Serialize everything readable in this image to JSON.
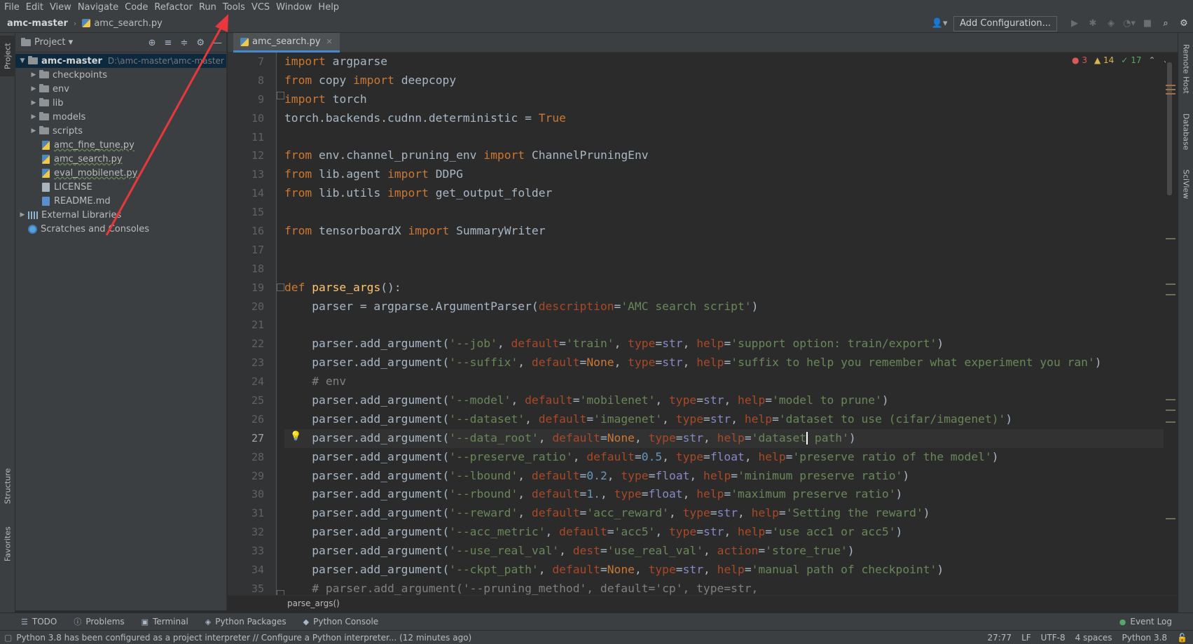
{
  "menu": [
    "File",
    "Edit",
    "View",
    "Navigate",
    "Code",
    "Refactor",
    "Run",
    "Tools",
    "VCS",
    "Window",
    "Help"
  ],
  "navbar": {
    "project": "amc-master",
    "file": "amc_search.py",
    "run_config": "Add Configuration..."
  },
  "left_strip": {
    "project": "Project",
    "structure": "Structure",
    "favorites": "Favorites"
  },
  "right_strip": {
    "remote_host": "Remote Host",
    "database": "Database",
    "sciview": "SciView"
  },
  "project_panel": {
    "title": "Project",
    "root": {
      "name": "amc-master",
      "path": "D:\\amc-master\\amc-master"
    },
    "folders": [
      "checkpoints",
      "env",
      "lib",
      "models",
      "scripts"
    ],
    "files": [
      "amc_fine_tune.py",
      "amc_search.py",
      "eval_mobilenet.py",
      "LICENSE",
      "README.md"
    ],
    "external_libraries": "External Libraries",
    "scratches": "Scratches and Consoles"
  },
  "editor": {
    "tab": "amc_search.py",
    "inspections": {
      "errors": "3",
      "warnings": "14",
      "ok": "17"
    },
    "line_numbers": [
      "7",
      "8",
      "9",
      "10",
      "11",
      "12",
      "13",
      "14",
      "15",
      "16",
      "17",
      "18",
      "19",
      "20",
      "21",
      "22",
      "23",
      "24",
      "25",
      "26",
      "27",
      "28",
      "29",
      "30",
      "31",
      "32",
      "33",
      "34",
      "35"
    ],
    "current_line": "27",
    "lines": [
      [
        [
          "kw",
          "import"
        ],
        [
          "",
          "argparse"
        ]
      ],
      [
        [
          "kw",
          "from"
        ],
        [
          "",
          "copy"
        ],
        [
          "kw",
          "import"
        ],
        [
          "",
          "deepcopy"
        ]
      ],
      [
        [
          "kw",
          "import"
        ],
        [
          "",
          "torch"
        ]
      ],
      [
        [
          "",
          "torch.backends.cudnn.deterministic = "
        ],
        [
          "kw",
          "True"
        ]
      ],
      [],
      [
        [
          "kw",
          "from"
        ],
        [
          "",
          "env.channel_pruning_env "
        ],
        [
          "kw",
          "import"
        ],
        [
          "",
          "ChannelPruningEnv"
        ]
      ],
      [
        [
          "kw",
          "from"
        ],
        [
          "",
          "lib.agent "
        ],
        [
          "kw",
          "import"
        ],
        [
          "",
          "DDPG"
        ]
      ],
      [
        [
          "kw",
          "from"
        ],
        [
          "",
          "lib.utils "
        ],
        [
          "kw",
          "import"
        ],
        [
          "",
          "get_output_folder"
        ]
      ],
      [],
      [
        [
          "kw",
          "from"
        ],
        [
          "",
          "tensorboardX "
        ],
        [
          "kw",
          "import"
        ],
        [
          "",
          "SummaryWriter"
        ]
      ],
      [],
      [],
      [
        [
          "kw",
          "def "
        ],
        [
          "fn",
          "parse_args"
        ],
        [
          "",
          "():"
        ]
      ],
      [
        [
          "",
          "    parser = argparse.ArgumentParser("
        ],
        [
          "pr",
          "description"
        ],
        [
          "",
          "="
        ],
        [
          "st",
          "'AMC search script'"
        ],
        [
          "",
          ")"
        ]
      ],
      [],
      [
        [
          "",
          "    parser.add_argument("
        ],
        [
          "st",
          "'--job'"
        ],
        [
          "",
          ", "
        ],
        [
          "pr",
          "default"
        ],
        [
          "",
          "="
        ],
        [
          "st",
          "'train'"
        ],
        [
          "",
          ", "
        ],
        [
          "pr",
          "type"
        ],
        [
          "",
          "="
        ],
        [
          "bi",
          "str"
        ],
        [
          "",
          ", "
        ],
        [
          "pr",
          "help"
        ],
        [
          "",
          "="
        ],
        [
          "st",
          "'support option: train/export'"
        ],
        [
          "",
          ")"
        ]
      ],
      [
        [
          "",
          "    parser.add_argument("
        ],
        [
          "st",
          "'--suffix'"
        ],
        [
          "",
          ", "
        ],
        [
          "pr",
          "default"
        ],
        [
          "",
          "="
        ],
        [
          "kw",
          "None"
        ],
        [
          "",
          ", "
        ],
        [
          "pr",
          "type"
        ],
        [
          "",
          "="
        ],
        [
          "bi",
          "str"
        ],
        [
          "",
          ", "
        ],
        [
          "pr",
          "help"
        ],
        [
          "",
          "="
        ],
        [
          "st",
          "'suffix to help you remember what experiment you ran'"
        ],
        [
          "",
          ")"
        ]
      ],
      [
        [
          "cm",
          "    # env"
        ]
      ],
      [
        [
          "",
          "    parser.add_argument("
        ],
        [
          "st",
          "'--model'"
        ],
        [
          "",
          ", "
        ],
        [
          "pr",
          "default"
        ],
        [
          "",
          "="
        ],
        [
          "st",
          "'mobilenet'"
        ],
        [
          "",
          ", "
        ],
        [
          "pr",
          "type"
        ],
        [
          "",
          "="
        ],
        [
          "bi",
          "str"
        ],
        [
          "",
          ", "
        ],
        [
          "pr",
          "help"
        ],
        [
          "",
          "="
        ],
        [
          "st",
          "'model to prune'"
        ],
        [
          "",
          ")"
        ]
      ],
      [
        [
          "",
          "    parser.add_argument("
        ],
        [
          "st",
          "'--dataset'"
        ],
        [
          "",
          ", "
        ],
        [
          "pr",
          "default"
        ],
        [
          "",
          "="
        ],
        [
          "st",
          "'imagenet'"
        ],
        [
          "",
          ", "
        ],
        [
          "pr",
          "type"
        ],
        [
          "",
          "="
        ],
        [
          "bi",
          "str"
        ],
        [
          "",
          ", "
        ],
        [
          "pr",
          "help"
        ],
        [
          "",
          "="
        ],
        [
          "st",
          "'dataset to use (cifar/imagenet)'"
        ],
        [
          "",
          ")"
        ]
      ],
      [
        [
          "",
          "    parser.add_argument("
        ],
        [
          "st",
          "'--data_root'"
        ],
        [
          "",
          ", "
        ],
        [
          "pr",
          "default"
        ],
        [
          "",
          "="
        ],
        [
          "kw",
          "None"
        ],
        [
          "",
          ", "
        ],
        [
          "pr",
          "type"
        ],
        [
          "",
          "="
        ],
        [
          "bi",
          "str"
        ],
        [
          "",
          ", "
        ],
        [
          "pr",
          "help"
        ],
        [
          "",
          "="
        ],
        [
          "st",
          "'dataset"
        ],
        [
          "caret",
          ""
        ],
        [
          "st",
          " path'"
        ],
        [
          "",
          ")"
        ]
      ],
      [
        [
          "",
          "    parser.add_argument("
        ],
        [
          "st",
          "'--preserve_ratio'"
        ],
        [
          "",
          ", "
        ],
        [
          "pr",
          "default"
        ],
        [
          "",
          "="
        ],
        [
          "nm",
          "0.5"
        ],
        [
          "",
          ", "
        ],
        [
          "pr",
          "type"
        ],
        [
          "",
          "="
        ],
        [
          "bi",
          "float"
        ],
        [
          "",
          ", "
        ],
        [
          "pr",
          "help"
        ],
        [
          "",
          "="
        ],
        [
          "st",
          "'preserve ratio of the model'"
        ],
        [
          "",
          ")"
        ]
      ],
      [
        [
          "",
          "    parser.add_argument("
        ],
        [
          "st",
          "'--lbound'"
        ],
        [
          "",
          ", "
        ],
        [
          "pr",
          "default"
        ],
        [
          "",
          "="
        ],
        [
          "nm",
          "0.2"
        ],
        [
          "",
          ", "
        ],
        [
          "pr",
          "type"
        ],
        [
          "",
          "="
        ],
        [
          "bi",
          "float"
        ],
        [
          "",
          ", "
        ],
        [
          "pr",
          "help"
        ],
        [
          "",
          "="
        ],
        [
          "st",
          "'minimum preserve ratio'"
        ],
        [
          "",
          ")"
        ]
      ],
      [
        [
          "",
          "    parser.add_argument("
        ],
        [
          "st",
          "'--rbound'"
        ],
        [
          "",
          ", "
        ],
        [
          "pr",
          "default"
        ],
        [
          "",
          "="
        ],
        [
          "nm",
          "1."
        ],
        [
          "",
          ", "
        ],
        [
          "pr",
          "type"
        ],
        [
          "",
          "="
        ],
        [
          "bi",
          "float"
        ],
        [
          "",
          ", "
        ],
        [
          "pr",
          "help"
        ],
        [
          "",
          "="
        ],
        [
          "st",
          "'maximum preserve ratio'"
        ],
        [
          "",
          ")"
        ]
      ],
      [
        [
          "",
          "    parser.add_argument("
        ],
        [
          "st",
          "'--reward'"
        ],
        [
          "",
          ", "
        ],
        [
          "pr",
          "default"
        ],
        [
          "",
          "="
        ],
        [
          "st",
          "'acc_reward'"
        ],
        [
          "",
          ", "
        ],
        [
          "pr",
          "type"
        ],
        [
          "",
          "="
        ],
        [
          "bi",
          "str"
        ],
        [
          "",
          ", "
        ],
        [
          "pr",
          "help"
        ],
        [
          "",
          "="
        ],
        [
          "st",
          "'Setting the reward'"
        ],
        [
          "",
          ")"
        ]
      ],
      [
        [
          "",
          "    parser.add_argument("
        ],
        [
          "st",
          "'--acc_metric'"
        ],
        [
          "",
          ", "
        ],
        [
          "pr",
          "default"
        ],
        [
          "",
          "="
        ],
        [
          "st",
          "'acc5'"
        ],
        [
          "",
          ", "
        ],
        [
          "pr",
          "type"
        ],
        [
          "",
          "="
        ],
        [
          "bi",
          "str"
        ],
        [
          "",
          ", "
        ],
        [
          "pr",
          "help"
        ],
        [
          "",
          "="
        ],
        [
          "st",
          "'use acc1 or acc5'"
        ],
        [
          "",
          ")"
        ]
      ],
      [
        [
          "",
          "    parser.add_argument("
        ],
        [
          "st",
          "'--use_real_val'"
        ],
        [
          "",
          ", "
        ],
        [
          "pr",
          "dest"
        ],
        [
          "",
          "="
        ],
        [
          "st",
          "'use_real_val'"
        ],
        [
          "",
          ", "
        ],
        [
          "pr",
          "action"
        ],
        [
          "",
          "="
        ],
        [
          "st",
          "'store_true'"
        ],
        [
          "",
          ")"
        ]
      ],
      [
        [
          "",
          "    parser.add_argument("
        ],
        [
          "st",
          "'--ckpt_path'"
        ],
        [
          "",
          ", "
        ],
        [
          "pr",
          "default"
        ],
        [
          "",
          "="
        ],
        [
          "kw",
          "None"
        ],
        [
          "",
          ", "
        ],
        [
          "pr",
          "type"
        ],
        [
          "",
          "="
        ],
        [
          "bi",
          "str"
        ],
        [
          "",
          ", "
        ],
        [
          "pr",
          "help"
        ],
        [
          "",
          "="
        ],
        [
          "st",
          "'manual path of checkpoint'"
        ],
        [
          "",
          ")"
        ]
      ],
      [
        [
          "cm",
          "    # parser.add_argument('--pruning_method', default='cp', type=str,"
        ]
      ]
    ],
    "breadcrumb": "parse_args()"
  },
  "tool_windows": [
    "TODO",
    "Problems",
    "Terminal",
    "Python Packages",
    "Python Console"
  ],
  "event_log": "Event Log",
  "status": {
    "message": "Python 3.8 has been configured as a project interpreter // Configure a Python interpreter... (12 minutes ago)",
    "position": "27:77",
    "line_sep": "LF",
    "encoding": "UTF-8",
    "indent": "4 spaces",
    "interpreter": "Python 3.8"
  },
  "colors": {
    "accent": "#4a88c7",
    "annotation_arrow": "#e8383d"
  }
}
